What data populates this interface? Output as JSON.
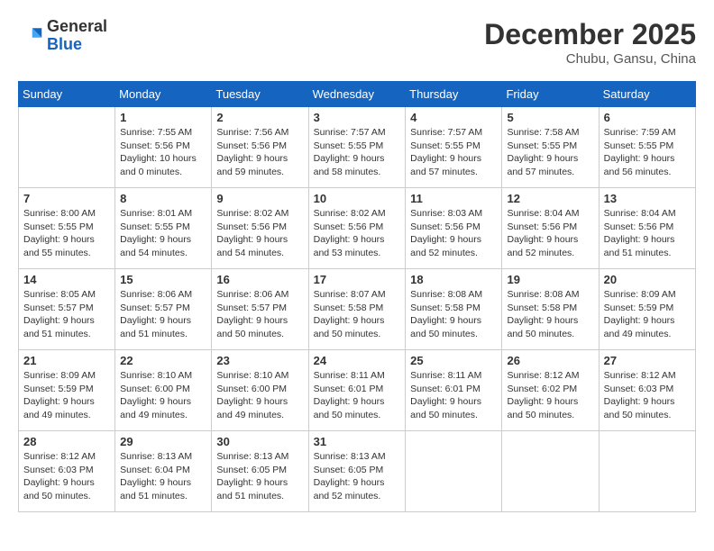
{
  "header": {
    "logo": {
      "general": "General",
      "blue": "Blue"
    },
    "title": "December 2025",
    "subtitle": "Chubu, Gansu, China"
  },
  "weekdays": [
    "Sunday",
    "Monday",
    "Tuesday",
    "Wednesday",
    "Thursday",
    "Friday",
    "Saturday"
  ],
  "weeks": [
    [
      {
        "day": null
      },
      {
        "day": 1,
        "sunrise": "7:55 AM",
        "sunset": "5:56 PM",
        "daylight": "10 hours and 0 minutes."
      },
      {
        "day": 2,
        "sunrise": "7:56 AM",
        "sunset": "5:56 PM",
        "daylight": "9 hours and 59 minutes."
      },
      {
        "day": 3,
        "sunrise": "7:57 AM",
        "sunset": "5:55 PM",
        "daylight": "9 hours and 58 minutes."
      },
      {
        "day": 4,
        "sunrise": "7:57 AM",
        "sunset": "5:55 PM",
        "daylight": "9 hours and 57 minutes."
      },
      {
        "day": 5,
        "sunrise": "7:58 AM",
        "sunset": "5:55 PM",
        "daylight": "9 hours and 57 minutes."
      },
      {
        "day": 6,
        "sunrise": "7:59 AM",
        "sunset": "5:55 PM",
        "daylight": "9 hours and 56 minutes."
      }
    ],
    [
      {
        "day": 7,
        "sunrise": "8:00 AM",
        "sunset": "5:55 PM",
        "daylight": "9 hours and 55 minutes."
      },
      {
        "day": 8,
        "sunrise": "8:01 AM",
        "sunset": "5:55 PM",
        "daylight": "9 hours and 54 minutes."
      },
      {
        "day": 9,
        "sunrise": "8:02 AM",
        "sunset": "5:56 PM",
        "daylight": "9 hours and 54 minutes."
      },
      {
        "day": 10,
        "sunrise": "8:02 AM",
        "sunset": "5:56 PM",
        "daylight": "9 hours and 53 minutes."
      },
      {
        "day": 11,
        "sunrise": "8:03 AM",
        "sunset": "5:56 PM",
        "daylight": "9 hours and 52 minutes."
      },
      {
        "day": 12,
        "sunrise": "8:04 AM",
        "sunset": "5:56 PM",
        "daylight": "9 hours and 52 minutes."
      },
      {
        "day": 13,
        "sunrise": "8:04 AM",
        "sunset": "5:56 PM",
        "daylight": "9 hours and 51 minutes."
      }
    ],
    [
      {
        "day": 14,
        "sunrise": "8:05 AM",
        "sunset": "5:57 PM",
        "daylight": "9 hours and 51 minutes."
      },
      {
        "day": 15,
        "sunrise": "8:06 AM",
        "sunset": "5:57 PM",
        "daylight": "9 hours and 51 minutes."
      },
      {
        "day": 16,
        "sunrise": "8:06 AM",
        "sunset": "5:57 PM",
        "daylight": "9 hours and 50 minutes."
      },
      {
        "day": 17,
        "sunrise": "8:07 AM",
        "sunset": "5:58 PM",
        "daylight": "9 hours and 50 minutes."
      },
      {
        "day": 18,
        "sunrise": "8:08 AM",
        "sunset": "5:58 PM",
        "daylight": "9 hours and 50 minutes."
      },
      {
        "day": 19,
        "sunrise": "8:08 AM",
        "sunset": "5:58 PM",
        "daylight": "9 hours and 50 minutes."
      },
      {
        "day": 20,
        "sunrise": "8:09 AM",
        "sunset": "5:59 PM",
        "daylight": "9 hours and 49 minutes."
      }
    ],
    [
      {
        "day": 21,
        "sunrise": "8:09 AM",
        "sunset": "5:59 PM",
        "daylight": "9 hours and 49 minutes."
      },
      {
        "day": 22,
        "sunrise": "8:10 AM",
        "sunset": "6:00 PM",
        "daylight": "9 hours and 49 minutes."
      },
      {
        "day": 23,
        "sunrise": "8:10 AM",
        "sunset": "6:00 PM",
        "daylight": "9 hours and 49 minutes."
      },
      {
        "day": 24,
        "sunrise": "8:11 AM",
        "sunset": "6:01 PM",
        "daylight": "9 hours and 50 minutes."
      },
      {
        "day": 25,
        "sunrise": "8:11 AM",
        "sunset": "6:01 PM",
        "daylight": "9 hours and 50 minutes."
      },
      {
        "day": 26,
        "sunrise": "8:12 AM",
        "sunset": "6:02 PM",
        "daylight": "9 hours and 50 minutes."
      },
      {
        "day": 27,
        "sunrise": "8:12 AM",
        "sunset": "6:03 PM",
        "daylight": "9 hours and 50 minutes."
      }
    ],
    [
      {
        "day": 28,
        "sunrise": "8:12 AM",
        "sunset": "6:03 PM",
        "daylight": "9 hours and 50 minutes."
      },
      {
        "day": 29,
        "sunrise": "8:13 AM",
        "sunset": "6:04 PM",
        "daylight": "9 hours and 51 minutes."
      },
      {
        "day": 30,
        "sunrise": "8:13 AM",
        "sunset": "6:05 PM",
        "daylight": "9 hours and 51 minutes."
      },
      {
        "day": 31,
        "sunrise": "8:13 AM",
        "sunset": "6:05 PM",
        "daylight": "9 hours and 52 minutes."
      },
      {
        "day": null
      },
      {
        "day": null
      },
      {
        "day": null
      }
    ]
  ]
}
